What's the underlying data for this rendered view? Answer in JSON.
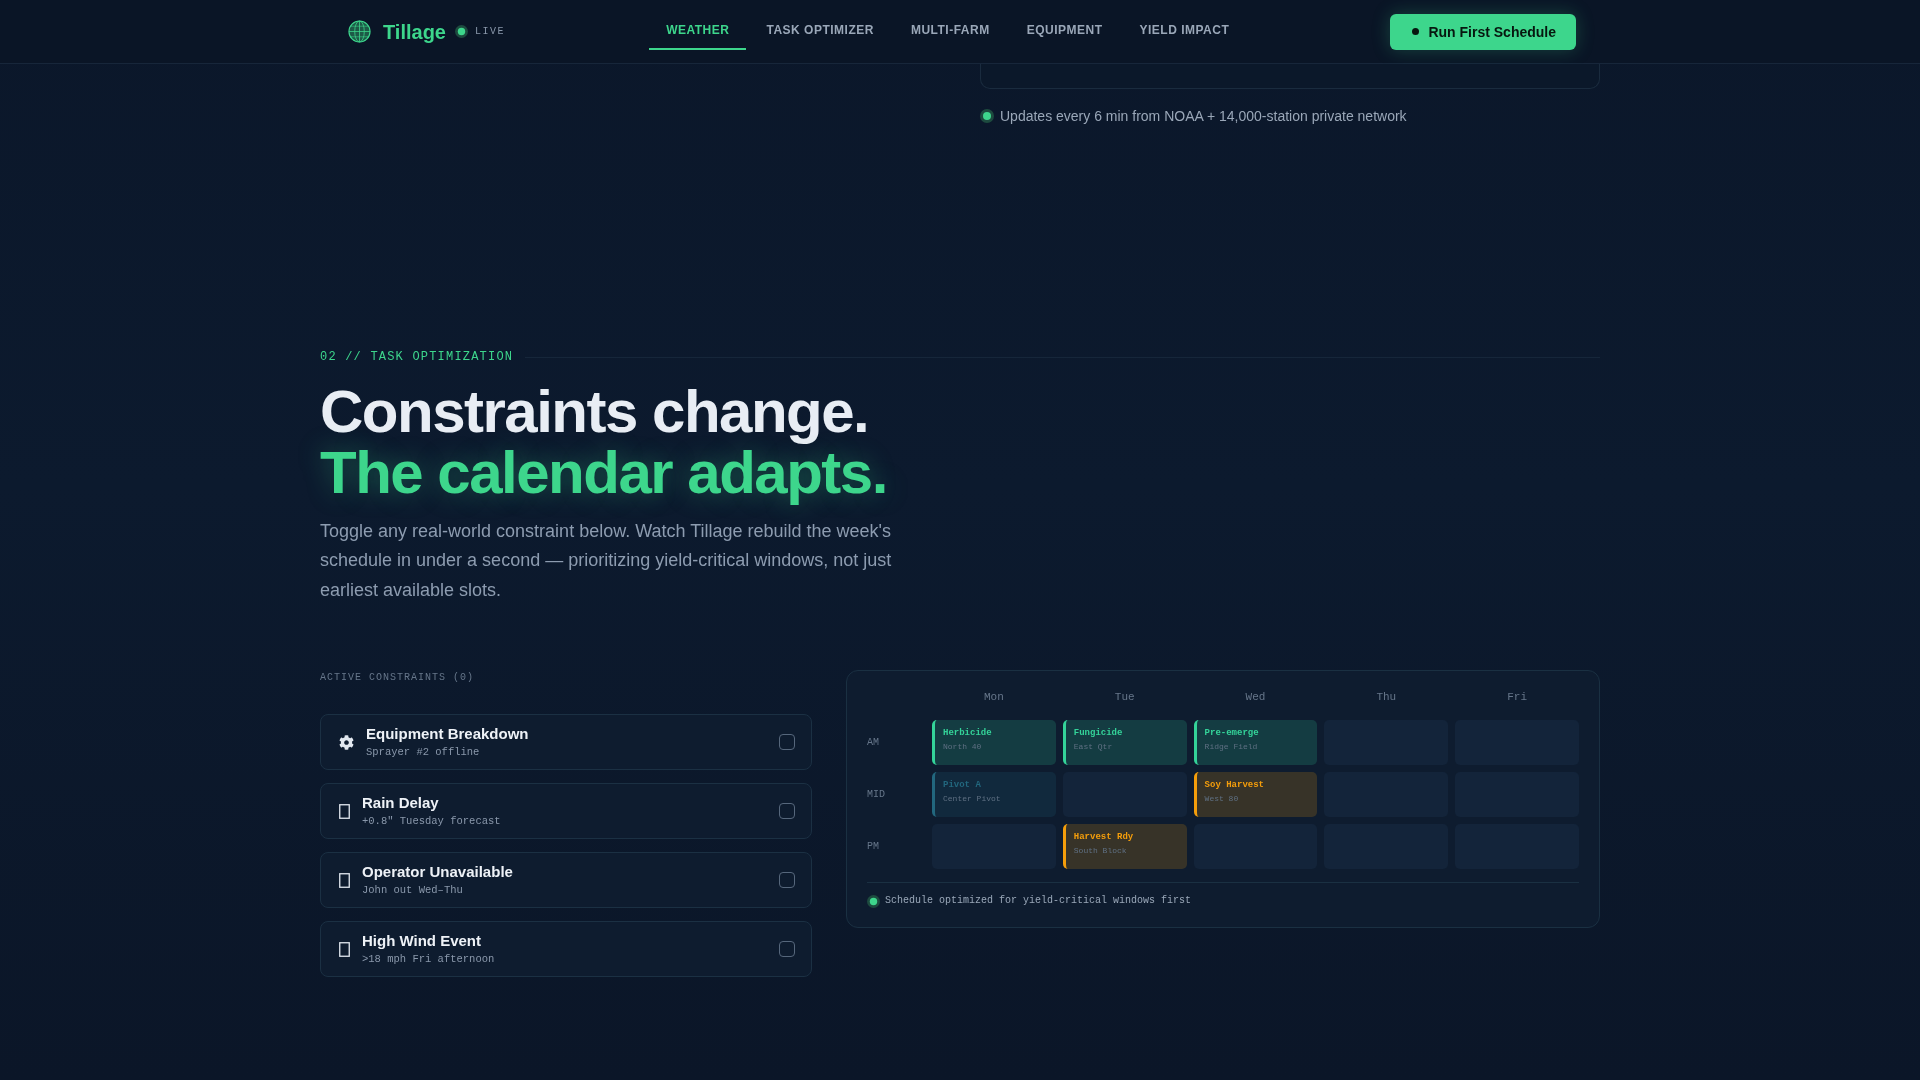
{
  "nav": {
    "brand": "Tillage",
    "live_label": "LIVE",
    "tabs": [
      {
        "label": "WEATHER",
        "selected": true
      },
      {
        "label": "TASK OPTIMIZER",
        "selected": false
      },
      {
        "label": "MULTI-FARM",
        "selected": false
      },
      {
        "label": "EQUIPMENT",
        "selected": false
      },
      {
        "label": "YIELD IMPACT",
        "selected": false
      }
    ],
    "cta": "Run First Schedule"
  },
  "weather": {
    "status": "Updates every 6 min from NOAA + 14,000-station private network"
  },
  "section": {
    "eyebrow": "02 // TASK OPTIMIZATION",
    "headline": "Constraints change.",
    "headline_accent": "The calendar adapts.",
    "intro": "Toggle any real-world constraint below. Watch Tillage rebuild the week's schedule in under a second — prioritizing yield-critical windows, not just earliest available slots."
  },
  "constraints": {
    "heading": "ACTIVE CONSTRAINTS (0)",
    "items": [
      {
        "kind": "gear",
        "title": "Equipment Breakdown",
        "detail": "Sprayer #2 offline",
        "checked": false
      },
      {
        "kind": "box",
        "title": "Rain Delay",
        "detail": "+0.8\" Tuesday forecast",
        "checked": false
      },
      {
        "kind": "box",
        "title": "Operator Unavailable",
        "detail": "John out Wed–Thu",
        "checked": false
      },
      {
        "kind": "box",
        "title": "High Wind Event",
        "detail": ">18 mph Fri afternoon",
        "checked": false
      }
    ]
  },
  "schedule": {
    "days": [
      "Mon",
      "Tue",
      "Wed",
      "Thu",
      "Fri"
    ],
    "rows": [
      {
        "label": "AM",
        "cells": [
          {
            "kind": "task",
            "title": "Herbicide",
            "detail": "North 40",
            "color": "#34d399"
          },
          {
            "kind": "task",
            "title": "Fungicide",
            "detail": "East Qtr",
            "color": "#34d399"
          },
          {
            "kind": "task",
            "title": "Pre-emerge",
            "detail": "Ridge Field",
            "color": "#34d399"
          },
          {
            "kind": "empty"
          },
          {
            "kind": "empty"
          }
        ]
      },
      {
        "label": "MID",
        "cells": [
          {
            "kind": "task",
            "title": "Pivot A",
            "detail": "Center Pivot",
            "color": "#22677e"
          },
          {
            "kind": "empty"
          },
          {
            "kind": "task",
            "title": "Soy Harvest",
            "detail": "West 80",
            "color": "#f59e0b"
          },
          {
            "kind": "empty"
          },
          {
            "kind": "empty"
          }
        ]
      },
      {
        "label": "PM",
        "cells": [
          {
            "kind": "empty"
          },
          {
            "kind": "task",
            "title": "Harvest Rdy",
            "detail": "South Block",
            "color": "#f59e0b"
          },
          {
            "kind": "empty"
          },
          {
            "kind": "empty"
          },
          {
            "kind": "empty"
          }
        ]
      }
    ],
    "footer": "Schedule optimized for yield-critical windows first"
  }
}
